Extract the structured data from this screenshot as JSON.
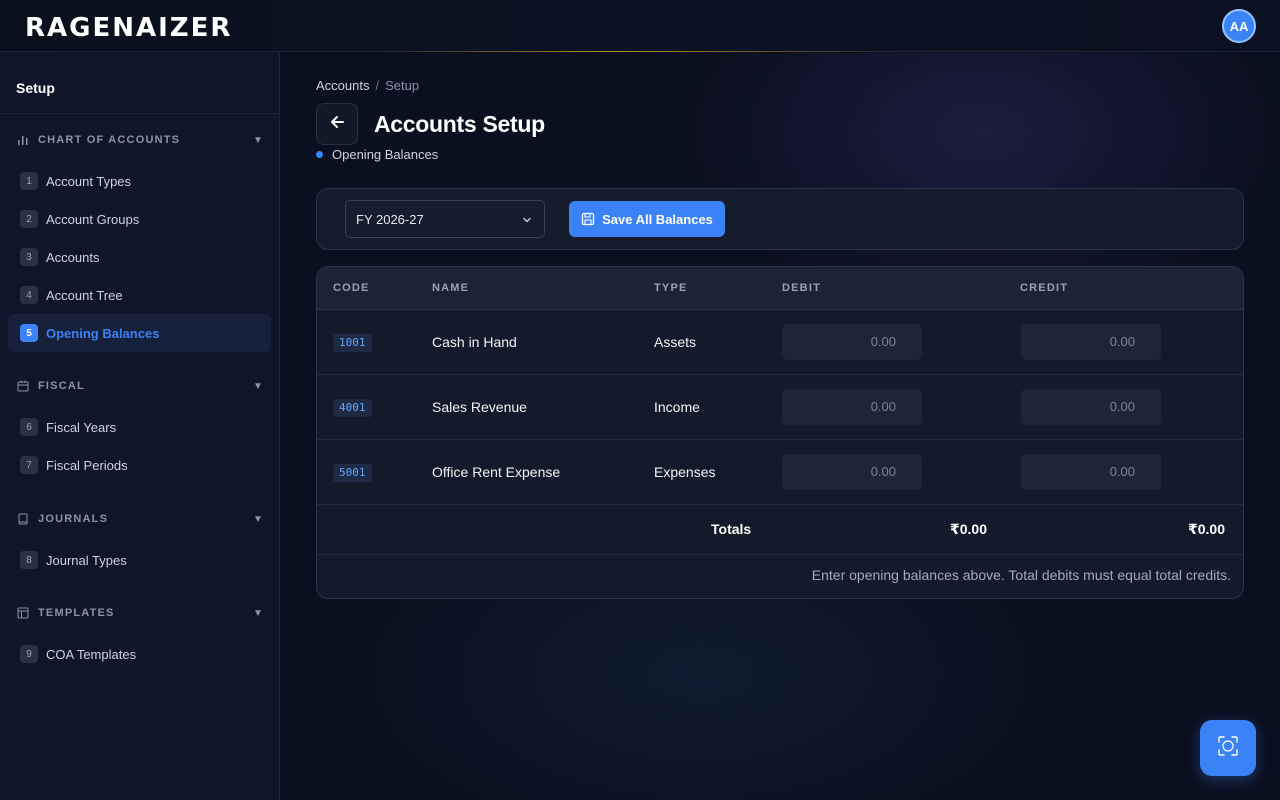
{
  "header": {
    "logo": "RAGENAIZER",
    "avatar_initials": "AA"
  },
  "sidebar": {
    "title": "Setup",
    "sections": [
      {
        "label": "CHART OF ACCOUNTS",
        "icon": "bar-chart-icon"
      },
      {
        "label": "FISCAL",
        "icon": "calendar-icon"
      },
      {
        "label": "JOURNALS",
        "icon": "book-icon"
      },
      {
        "label": "TEMPLATES",
        "icon": "layout-icon"
      }
    ],
    "items": [
      {
        "num": "1",
        "label": "Account Types"
      },
      {
        "num": "2",
        "label": "Account Groups"
      },
      {
        "num": "3",
        "label": "Accounts"
      },
      {
        "num": "4",
        "label": "Account Tree"
      },
      {
        "num": "5",
        "label": "Opening Balances",
        "active": true
      },
      {
        "num": "6",
        "label": "Fiscal Years"
      },
      {
        "num": "7",
        "label": "Fiscal Periods"
      },
      {
        "num": "8",
        "label": "Journal Types"
      },
      {
        "num": "9",
        "label": "COA Templates"
      }
    ]
  },
  "breadcrumb": {
    "parent": "Accounts",
    "separator": "/",
    "current": "Setup"
  },
  "page": {
    "title": "Accounts Setup",
    "subtitle": "Opening Balances"
  },
  "toolbar": {
    "fiscal_year": "FY 2026-27",
    "save_label": "Save All Balances"
  },
  "table": {
    "columns": [
      "CODE",
      "NAME",
      "TYPE",
      "DEBIT",
      "CREDIT"
    ],
    "rows": [
      {
        "code": "1001",
        "name": "Cash in Hand",
        "type": "Assets",
        "debit": "0.00",
        "credit": "0.00"
      },
      {
        "code": "4001",
        "name": "Sales Revenue",
        "type": "Income",
        "debit": "0.00",
        "credit": "0.00"
      },
      {
        "code": "5001",
        "name": "Office Rent Expense",
        "type": "Expenses",
        "debit": "0.00",
        "credit": "0.00"
      }
    ],
    "totals": {
      "label": "Totals",
      "debit": "₹0.00",
      "credit": "₹0.00"
    },
    "hint": "Enter opening balances above. Total debits must equal total credits."
  },
  "colors": {
    "accent": "#3b82f6",
    "background": "#0b1020",
    "sidebar": "#0f1629"
  }
}
